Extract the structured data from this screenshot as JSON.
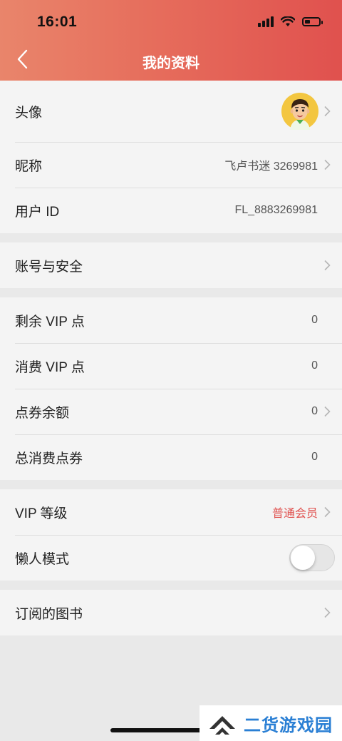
{
  "status_bar": {
    "time": "16:01"
  },
  "header": {
    "title": "我的资料"
  },
  "profile": {
    "avatar_label": "头像",
    "nickname_label": "昵称",
    "nickname_value": "飞卢书迷 3269981",
    "user_id_label": "用户 ID",
    "user_id_value": "FL_8883269981"
  },
  "account": {
    "security_label": "账号与安全"
  },
  "vip_points": {
    "remaining_label": "剩余 VIP 点",
    "remaining_value": "0",
    "spent_label": "消费 VIP 点",
    "spent_value": "0",
    "coupon_balance_label": "点券余额",
    "coupon_balance_value": "0",
    "total_coupon_spent_label": "总消费点券",
    "total_coupon_spent_value": "0"
  },
  "settings": {
    "vip_level_label": "VIP 等级",
    "vip_level_value": "普通会员",
    "lazy_mode_label": "懒人模式",
    "lazy_mode_on": false
  },
  "subscriptions": {
    "label": "订阅的图书"
  },
  "watermark": {
    "text": "二货游戏园"
  },
  "colors": {
    "accent": "#e0514e",
    "header_start": "#e9856b",
    "header_end": "#e0514e",
    "watermark": "#2a7fd4"
  }
}
